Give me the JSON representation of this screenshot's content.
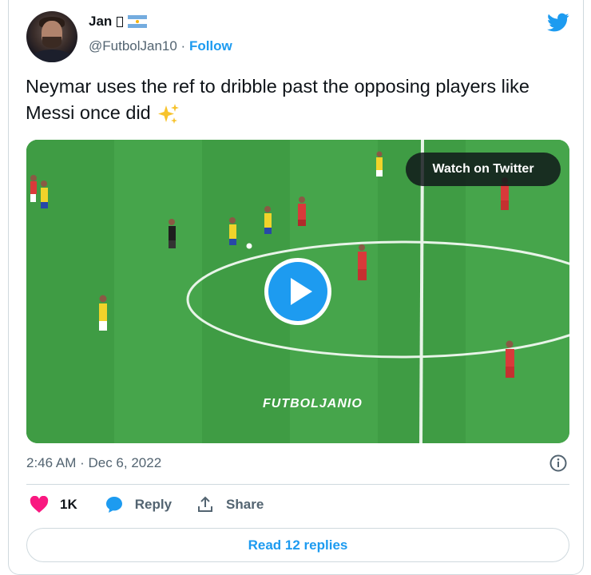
{
  "author": {
    "name": "Jan",
    "name_glyph": "□",
    "handle": "@FutbolJan10",
    "separator": " · ",
    "follow_label": "Follow"
  },
  "tweet": {
    "text": "Neymar uses the ref to dribble past the opposing players like Messi once did"
  },
  "media": {
    "watch_label": "Watch on Twitter",
    "watermark": "FUTBOLJANIO"
  },
  "meta": {
    "timestamp": "2:46 AM · Dec 6, 2022"
  },
  "actions": {
    "like_count": "1K",
    "reply_label": "Reply",
    "share_label": "Share"
  },
  "read_replies_label": "Read 12 replies",
  "colors": {
    "accent": "#1d9bf0",
    "like": "#f91880",
    "secondary_text": "#536471",
    "border": "#cfd9de",
    "pitch": "#45a54a"
  },
  "icons": [
    "twitter-bird-icon",
    "play-icon",
    "info-icon",
    "heart-icon",
    "reply-bubble-icon",
    "share-icon",
    "sparkles-icon",
    "argentina-flag-icon"
  ]
}
